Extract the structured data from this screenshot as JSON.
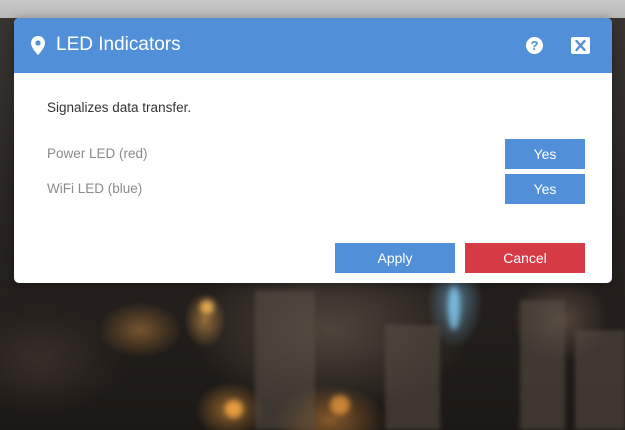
{
  "dialog": {
    "title": "LED Indicators",
    "header_icon": "location-pin-icon",
    "help_label": "?",
    "help_icon": "help-icon",
    "close_icon": "close-icon",
    "description": "Signalizes data transfer.",
    "settings": [
      {
        "label": "Power LED (red)",
        "value": "Yes"
      },
      {
        "label": "WiFi LED (blue)",
        "value": "Yes"
      }
    ],
    "apply_label": "Apply",
    "cancel_label": "Cancel"
  },
  "colors": {
    "accent": "#5190d8",
    "danger": "#d63a45",
    "label_gray": "#8a8a8a",
    "text_dark": "#333333"
  }
}
